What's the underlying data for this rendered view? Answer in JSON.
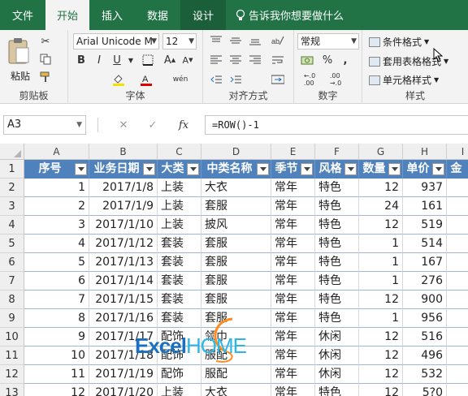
{
  "tabs": [
    "文件",
    "开始",
    "插入",
    "数据",
    "设计"
  ],
  "tell_me": "告诉我你想要做什么",
  "ribbon": {
    "clipboard": {
      "paste_label": "粘贴",
      "group_label": "剪贴板"
    },
    "font": {
      "font_name": "Arial Unicode M",
      "font_size": "12",
      "group_label": "字体",
      "bold": "B",
      "italic": "I",
      "underline": "U",
      "phonetic": "wén"
    },
    "alignment": {
      "group_label": "对齐方式"
    },
    "number": {
      "format": "常规",
      "percent": "%",
      "comma": ",",
      "group_label": "数字"
    },
    "styles": {
      "conditional": "条件格式",
      "table_format": "套用表格格式",
      "cell_styles": "单元格样式",
      "group_label": "样式"
    }
  },
  "formula_bar": {
    "name_box": "A3",
    "cancel": "✕",
    "enter": "✓",
    "fx": "fx",
    "formula": "=ROW()-1"
  },
  "columns": [
    "A",
    "B",
    "C",
    "D",
    "E",
    "F",
    "G",
    "H",
    "I"
  ],
  "row_numbers": [
    "1",
    "2",
    "3",
    "4",
    "5",
    "6",
    "7",
    "8",
    "9",
    "10",
    "11",
    "12",
    "13"
  ],
  "table": {
    "headers": [
      "序号",
      "业务日期",
      "大类",
      "中类名称",
      "季节",
      "风格",
      "数量",
      "单价",
      "金"
    ],
    "rows": [
      [
        "1",
        "2017/1/8",
        "上装",
        "大衣",
        "常年",
        "特色",
        "12",
        "937"
      ],
      [
        "2",
        "2017/1/9",
        "上装",
        "套服",
        "常年",
        "特色",
        "24",
        "161"
      ],
      [
        "3",
        "2017/1/10",
        "上装",
        "披风",
        "常年",
        "特色",
        "12",
        "519"
      ],
      [
        "4",
        "2017/1/12",
        "套装",
        "套服",
        "常年",
        "特色",
        "1",
        "514"
      ],
      [
        "5",
        "2017/1/13",
        "套装",
        "套服",
        "常年",
        "特色",
        "1",
        "167"
      ],
      [
        "6",
        "2017/1/14",
        "套装",
        "套服",
        "常年",
        "特色",
        "1",
        "276"
      ],
      [
        "7",
        "2017/1/15",
        "套装",
        "套服",
        "常年",
        "特色",
        "12",
        "900"
      ],
      [
        "8",
        "2017/1/16",
        "套装",
        "套服",
        "常年",
        "特色",
        "1",
        "956"
      ],
      [
        "9",
        "2017/1/17",
        "配饰",
        "领巾",
        "常年",
        "休闲",
        "12",
        "516"
      ],
      [
        "10",
        "2017/1/18",
        "配饰",
        "服配",
        "常年",
        "休闲",
        "12",
        "496"
      ],
      [
        "11",
        "2017/1/19",
        "配饰",
        "服配",
        "常年",
        "休闲",
        "12",
        "532"
      ],
      [
        "12",
        "2017/1/20",
        "上装",
        "大衣",
        "常年",
        "特色",
        "12",
        "5?0"
      ]
    ]
  },
  "watermark": {
    "text_left": "Excel",
    "text_right": "HOME"
  },
  "colors": {
    "accent": "#217346",
    "header_fill": "#4f81bd"
  }
}
